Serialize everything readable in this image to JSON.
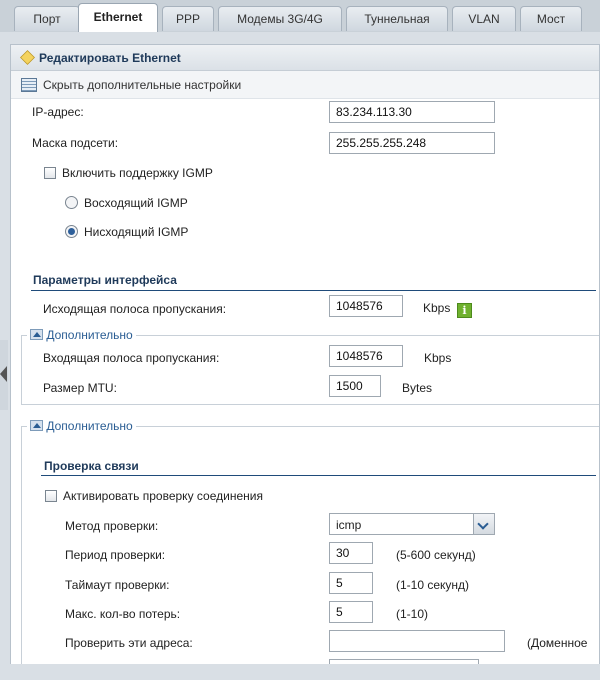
{
  "tabs": [
    "Порт",
    "Ethernet",
    "PPP",
    "Модемы 3G/4G",
    "Туннельная",
    "VLAN",
    "Мост"
  ],
  "active_tab": "Ethernet",
  "dialog": {
    "title": "Редактировать Ethernet",
    "toggle_advanced": "Скрыть дополнительные настройки"
  },
  "ip": {
    "label": "IP-адрес:",
    "value": "83.234.113.30"
  },
  "mask": {
    "label": "Маска подсети:",
    "value": "255.255.255.248"
  },
  "igmp": {
    "enable_label": "Включить поддержку IGMP",
    "enabled": false,
    "upstream_label": "Восходящий IGMP",
    "downstream_label": "Нисходящий IGMP",
    "selected": "downstream"
  },
  "iface": {
    "section_title": "Параметры интерфейса",
    "egress_label": "Исходящая полоса пропускания:",
    "egress_value": "1048576",
    "egress_unit": "Kbps",
    "advanced_legend": "Дополнительно",
    "ingress_label": "Входящая полоса пропускания:",
    "ingress_value": "1048576",
    "ingress_unit": "Kbps",
    "mtu_label": "Размер MTU:",
    "mtu_value": "1500",
    "mtu_unit": "Bytes"
  },
  "advanced2": {
    "legend": "Дополнительно",
    "check_section_title": "Проверка связи",
    "activate_label": "Активировать проверку соединения",
    "activate_checked": false,
    "method_label": "Метод проверки:",
    "method_value": "icmp",
    "period_label": "Период проверки:",
    "period_value": "30",
    "period_hint": "(5-600 секунд)",
    "timeout_label": "Таймаут проверки:",
    "timeout_value": "5",
    "timeout_hint": "(1-10 секунд)",
    "max_loss_label": "Макс. кол-во потерь:",
    "max_loss_value": "5",
    "max_loss_hint": "(1-10)",
    "addresses_label": "Проверить эти адреса:",
    "addresses_value": "",
    "addresses_hint": "(Доменное"
  },
  "colors": {
    "accent": "#1f3a5a",
    "link": "#2a5d93",
    "info_green": "#6fb12e"
  }
}
